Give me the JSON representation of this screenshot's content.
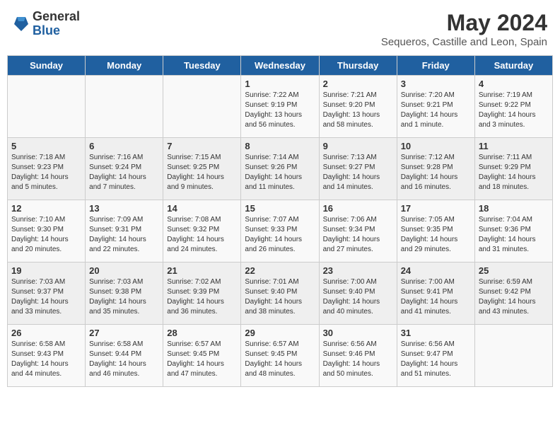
{
  "header": {
    "logo_general": "General",
    "logo_blue": "Blue",
    "month_title": "May 2024",
    "location": "Sequeros, Castille and Leon, Spain"
  },
  "days_of_week": [
    "Sunday",
    "Monday",
    "Tuesday",
    "Wednesday",
    "Thursday",
    "Friday",
    "Saturday"
  ],
  "weeks": [
    [
      {
        "day": "",
        "info": ""
      },
      {
        "day": "",
        "info": ""
      },
      {
        "day": "",
        "info": ""
      },
      {
        "day": "1",
        "info": "Sunrise: 7:22 AM\nSunset: 9:19 PM\nDaylight: 13 hours\nand 56 minutes."
      },
      {
        "day": "2",
        "info": "Sunrise: 7:21 AM\nSunset: 9:20 PM\nDaylight: 13 hours\nand 58 minutes."
      },
      {
        "day": "3",
        "info": "Sunrise: 7:20 AM\nSunset: 9:21 PM\nDaylight: 14 hours\nand 1 minute."
      },
      {
        "day": "4",
        "info": "Sunrise: 7:19 AM\nSunset: 9:22 PM\nDaylight: 14 hours\nand 3 minutes."
      }
    ],
    [
      {
        "day": "5",
        "info": "Sunrise: 7:18 AM\nSunset: 9:23 PM\nDaylight: 14 hours\nand 5 minutes."
      },
      {
        "day": "6",
        "info": "Sunrise: 7:16 AM\nSunset: 9:24 PM\nDaylight: 14 hours\nand 7 minutes."
      },
      {
        "day": "7",
        "info": "Sunrise: 7:15 AM\nSunset: 9:25 PM\nDaylight: 14 hours\nand 9 minutes."
      },
      {
        "day": "8",
        "info": "Sunrise: 7:14 AM\nSunset: 9:26 PM\nDaylight: 14 hours\nand 11 minutes."
      },
      {
        "day": "9",
        "info": "Sunrise: 7:13 AM\nSunset: 9:27 PM\nDaylight: 14 hours\nand 14 minutes."
      },
      {
        "day": "10",
        "info": "Sunrise: 7:12 AM\nSunset: 9:28 PM\nDaylight: 14 hours\nand 16 minutes."
      },
      {
        "day": "11",
        "info": "Sunrise: 7:11 AM\nSunset: 9:29 PM\nDaylight: 14 hours\nand 18 minutes."
      }
    ],
    [
      {
        "day": "12",
        "info": "Sunrise: 7:10 AM\nSunset: 9:30 PM\nDaylight: 14 hours\nand 20 minutes."
      },
      {
        "day": "13",
        "info": "Sunrise: 7:09 AM\nSunset: 9:31 PM\nDaylight: 14 hours\nand 22 minutes."
      },
      {
        "day": "14",
        "info": "Sunrise: 7:08 AM\nSunset: 9:32 PM\nDaylight: 14 hours\nand 24 minutes."
      },
      {
        "day": "15",
        "info": "Sunrise: 7:07 AM\nSunset: 9:33 PM\nDaylight: 14 hours\nand 26 minutes."
      },
      {
        "day": "16",
        "info": "Sunrise: 7:06 AM\nSunset: 9:34 PM\nDaylight: 14 hours\nand 27 minutes."
      },
      {
        "day": "17",
        "info": "Sunrise: 7:05 AM\nSunset: 9:35 PM\nDaylight: 14 hours\nand 29 minutes."
      },
      {
        "day": "18",
        "info": "Sunrise: 7:04 AM\nSunset: 9:36 PM\nDaylight: 14 hours\nand 31 minutes."
      }
    ],
    [
      {
        "day": "19",
        "info": "Sunrise: 7:03 AM\nSunset: 9:37 PM\nDaylight: 14 hours\nand 33 minutes."
      },
      {
        "day": "20",
        "info": "Sunrise: 7:03 AM\nSunset: 9:38 PM\nDaylight: 14 hours\nand 35 minutes."
      },
      {
        "day": "21",
        "info": "Sunrise: 7:02 AM\nSunset: 9:39 PM\nDaylight: 14 hours\nand 36 minutes."
      },
      {
        "day": "22",
        "info": "Sunrise: 7:01 AM\nSunset: 9:40 PM\nDaylight: 14 hours\nand 38 minutes."
      },
      {
        "day": "23",
        "info": "Sunrise: 7:00 AM\nSunset: 9:40 PM\nDaylight: 14 hours\nand 40 minutes."
      },
      {
        "day": "24",
        "info": "Sunrise: 7:00 AM\nSunset: 9:41 PM\nDaylight: 14 hours\nand 41 minutes."
      },
      {
        "day": "25",
        "info": "Sunrise: 6:59 AM\nSunset: 9:42 PM\nDaylight: 14 hours\nand 43 minutes."
      }
    ],
    [
      {
        "day": "26",
        "info": "Sunrise: 6:58 AM\nSunset: 9:43 PM\nDaylight: 14 hours\nand 44 minutes."
      },
      {
        "day": "27",
        "info": "Sunrise: 6:58 AM\nSunset: 9:44 PM\nDaylight: 14 hours\nand 46 minutes."
      },
      {
        "day": "28",
        "info": "Sunrise: 6:57 AM\nSunset: 9:45 PM\nDaylight: 14 hours\nand 47 minutes."
      },
      {
        "day": "29",
        "info": "Sunrise: 6:57 AM\nSunset: 9:45 PM\nDaylight: 14 hours\nand 48 minutes."
      },
      {
        "day": "30",
        "info": "Sunrise: 6:56 AM\nSunset: 9:46 PM\nDaylight: 14 hours\nand 50 minutes."
      },
      {
        "day": "31",
        "info": "Sunrise: 6:56 AM\nSunset: 9:47 PM\nDaylight: 14 hours\nand 51 minutes."
      },
      {
        "day": "",
        "info": ""
      }
    ]
  ]
}
